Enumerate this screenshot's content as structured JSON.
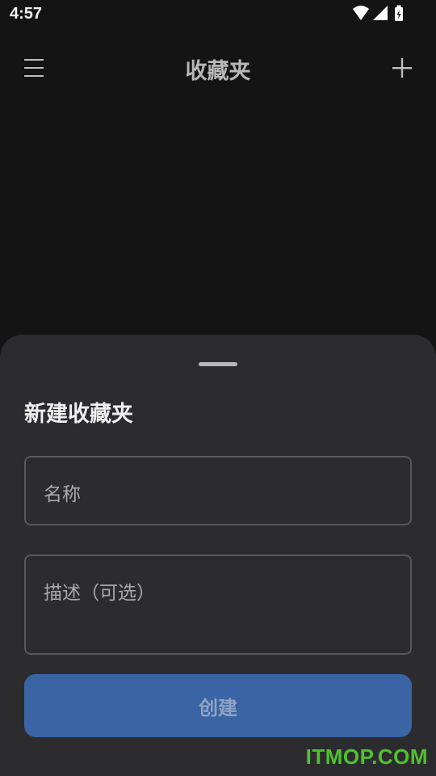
{
  "status_bar": {
    "time": "4:57",
    "icons": [
      "wifi-icon",
      "signal-icon",
      "battery-charging-icon"
    ]
  },
  "app_bar": {
    "title": "收藏夹",
    "left_icon": "menu-icon",
    "right_icon": "add-icon"
  },
  "sheet": {
    "title": "新建收藏夹",
    "name_field": {
      "placeholder": "名称",
      "value": ""
    },
    "description_field": {
      "placeholder": "描述（可选）",
      "value": ""
    },
    "create_button": "创建"
  },
  "watermark": "ITMOP.COM",
  "colors": {
    "background": "#141414",
    "sheet": "#2c2c2f",
    "primary_button": "#3a64a3",
    "watermark": "#4fc22d"
  }
}
